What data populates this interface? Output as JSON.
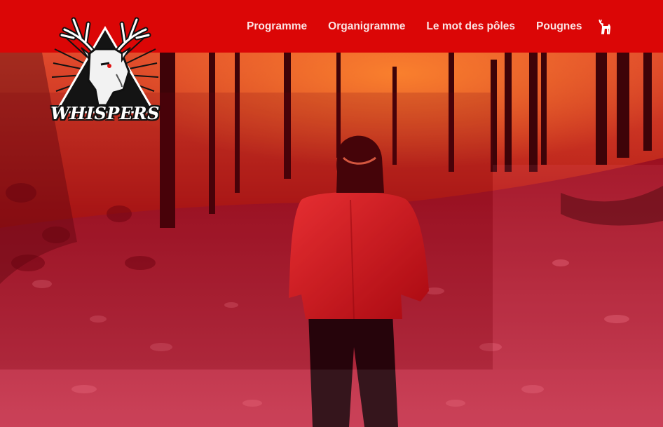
{
  "brand": {
    "logo_text": "WHISPERS",
    "logo_icon": "deer-head-icon"
  },
  "nav": {
    "items": [
      {
        "label": "Programme"
      },
      {
        "label": "Organigramme"
      },
      {
        "label": "Le mot des pôles"
      },
      {
        "label": "Pougnes"
      }
    ],
    "extra_icon": "deer-icon"
  },
  "hero": {
    "image": "person-in-red-jacket-walking-through-autumn-forest"
  },
  "colors": {
    "header_bg": "#db0606",
    "nav_text": "#fbe4e4",
    "hero_tint": "#b40a1e"
  }
}
